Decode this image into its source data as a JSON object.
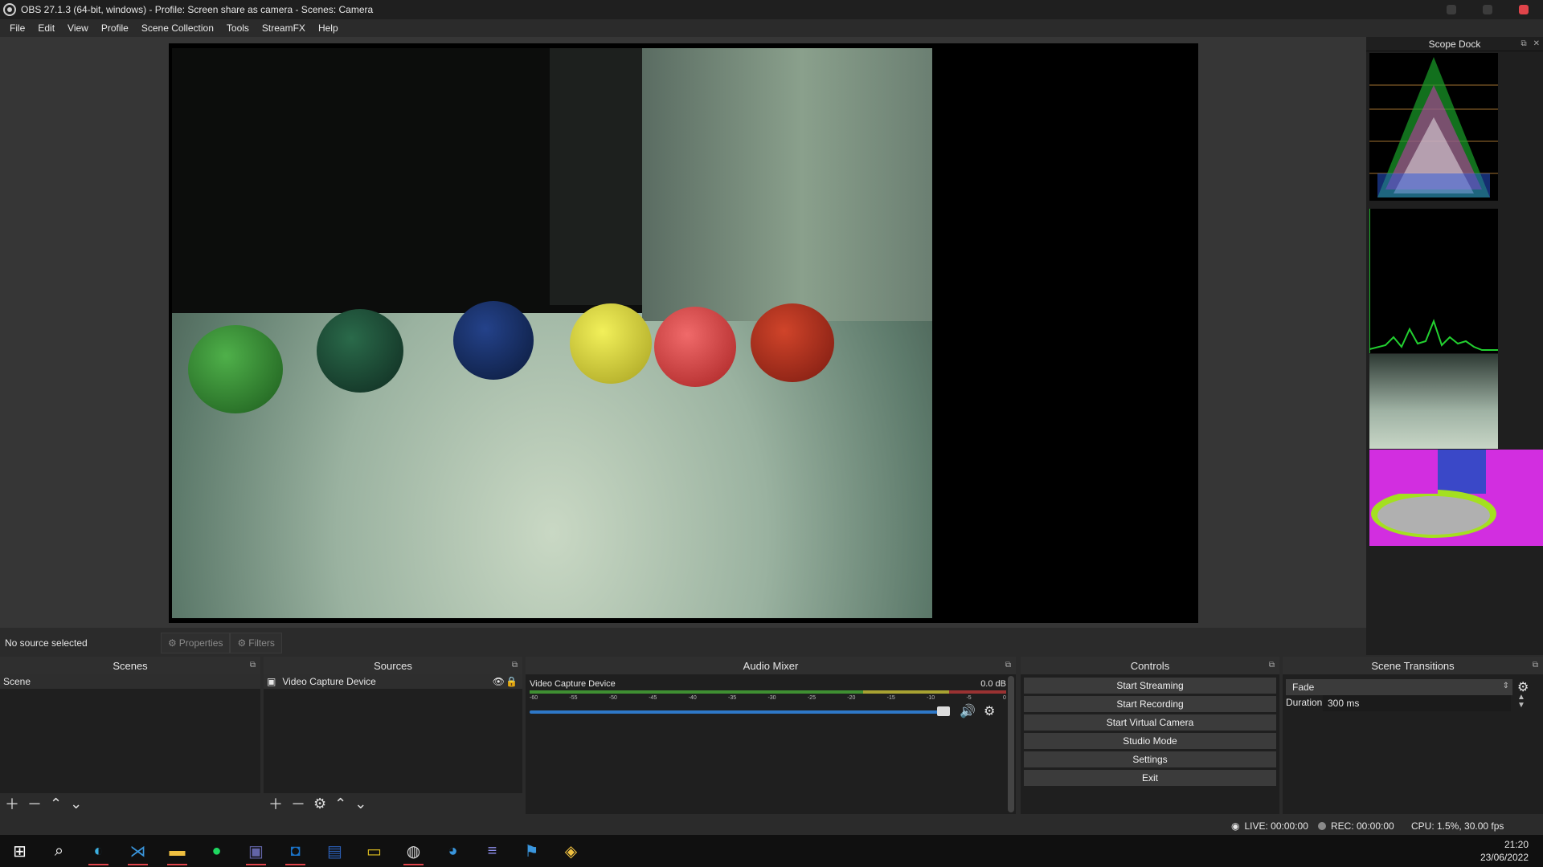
{
  "window": {
    "title": "OBS 27.1.3 (64-bit, windows) - Profile: Screen share as camera - Scenes: Camera"
  },
  "menu": [
    "File",
    "Edit",
    "View",
    "Profile",
    "Scene Collection",
    "Tools",
    "StreamFX",
    "Help"
  ],
  "scope_dock": {
    "title": "Scope Dock"
  },
  "source_toolbar": {
    "status": "No source selected",
    "properties_label": "Properties",
    "filters_label": "Filters"
  },
  "scenes": {
    "title": "Scenes",
    "items": [
      "Scene"
    ]
  },
  "sources": {
    "title": "Sources",
    "items": [
      {
        "label": "Video Capture Device"
      }
    ]
  },
  "audio_mixer": {
    "title": "Audio Mixer",
    "channel": {
      "name": "Video Capture Device",
      "level": "0.0 dB"
    },
    "scale": [
      "-60",
      "-55",
      "-50",
      "-45",
      "-40",
      "-35",
      "-30",
      "-25",
      "-20",
      "-15",
      "-10",
      "-5",
      "0"
    ],
    "volume_fraction": 0.99
  },
  "controls": {
    "title": "Controls",
    "buttons": [
      "Start Streaming",
      "Start Recording",
      "Start Virtual Camera",
      "Studio Mode",
      "Settings",
      "Exit"
    ]
  },
  "scene_transitions": {
    "title": "Scene Transitions",
    "selected": "Fade",
    "duration_label": "Duration",
    "duration_value": "300 ms"
  },
  "status": {
    "live": "LIVE: 00:00:00",
    "rec": "REC: 00:00:00",
    "cpu": "CPU: 1.5%, 30.00 fps"
  },
  "taskbar": {
    "time": "21:20",
    "date": "23/06/2022",
    "icons": [
      "windows-start-icon",
      "search-icon",
      "edge-dev-icon",
      "vscode-icon",
      "file-explorer-icon",
      "spotify-icon",
      "teams-icon",
      "outlook-icon",
      "word-icon",
      "filezilla-icon",
      "obs-icon",
      "globe-icon",
      "terminal-icon",
      "network-icon",
      "python-icon"
    ]
  },
  "colors": {
    "bg": "#2b2b2b",
    "dock_body": "#1f1f1f",
    "accent_fader": "#2e78c8",
    "close_red": "#e0444a"
  }
}
